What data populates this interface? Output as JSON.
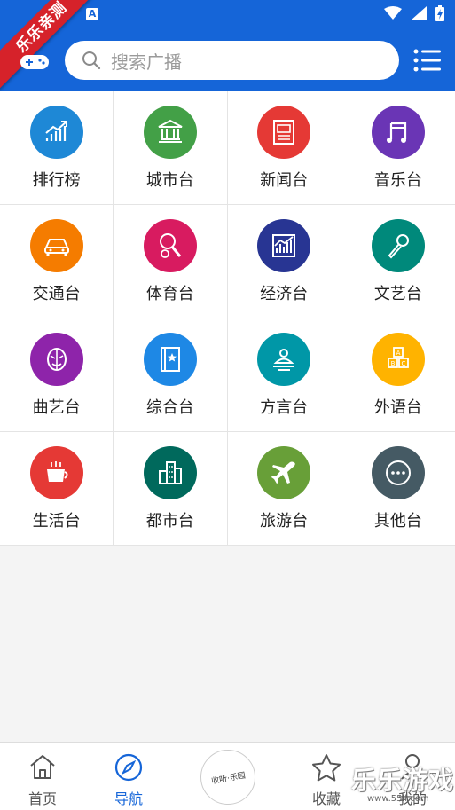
{
  "status": {
    "notification_letter": "A"
  },
  "ribbon": {
    "text": "乐乐亲测"
  },
  "search": {
    "placeholder": "搜索广播"
  },
  "categories": [
    {
      "label": "排行榜",
      "color": "#1e88d6",
      "icon": "chart-up-icon"
    },
    {
      "label": "城市台",
      "color": "#43a047",
      "icon": "building-columns-icon"
    },
    {
      "label": "新闻台",
      "color": "#e53935",
      "icon": "newspaper-icon"
    },
    {
      "label": "音乐台",
      "color": "#6a35b5",
      "icon": "music-note-icon"
    },
    {
      "label": "交通台",
      "color": "#f57c00",
      "icon": "car-icon"
    },
    {
      "label": "体育台",
      "color": "#d81b60",
      "icon": "racket-icon"
    },
    {
      "label": "经济台",
      "color": "#283593",
      "icon": "stock-chart-icon"
    },
    {
      "label": "文艺台",
      "color": "#00897b",
      "icon": "microphone-icon"
    },
    {
      "label": "曲艺台",
      "color": "#8e24aa",
      "icon": "opera-mask-icon"
    },
    {
      "label": "综合台",
      "color": "#1e88e5",
      "icon": "book-star-icon"
    },
    {
      "label": "方言台",
      "color": "#0097a7",
      "icon": "speaker-person-icon"
    },
    {
      "label": "外语台",
      "color": "#ffb300",
      "icon": "abc-blocks-icon"
    },
    {
      "label": "生活台",
      "color": "#e53935",
      "icon": "coffee-cup-icon"
    },
    {
      "label": "都市台",
      "color": "#00695c",
      "icon": "city-buildings-icon"
    },
    {
      "label": "旅游台",
      "color": "#689f38",
      "icon": "airplane-icon"
    },
    {
      "label": "其他台",
      "color": "#455a64",
      "icon": "more-dots-icon"
    }
  ],
  "nav": {
    "home": "首页",
    "navigate": "导航",
    "center_text": "收听·乐园",
    "favorites": "收藏",
    "profile": "我的"
  },
  "watermark": {
    "text": "乐乐游戏",
    "url": "www.55ll.com"
  },
  "colors": {
    "brand": "#1565d8",
    "active": "#1565d8"
  }
}
